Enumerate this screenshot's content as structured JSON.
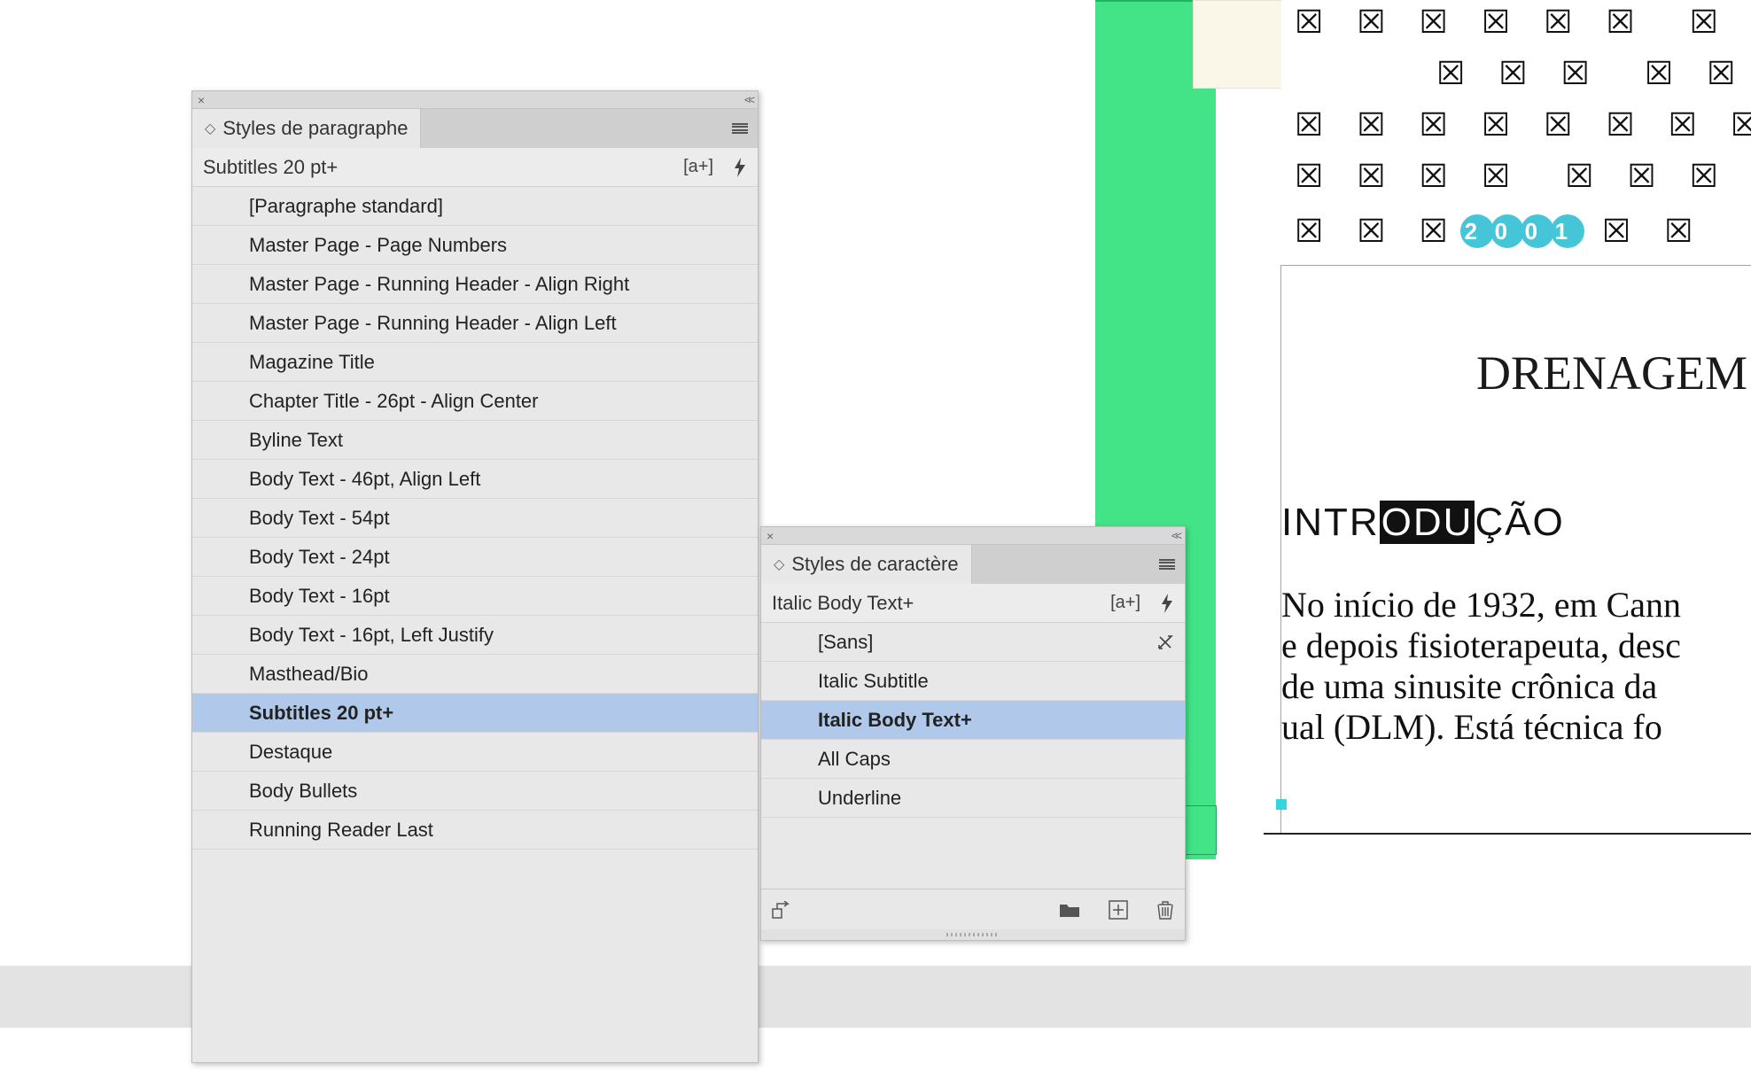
{
  "paragraphPanel": {
    "title": "Styles de paragraphe",
    "currentStyle": "Subtitles 20 pt+",
    "items": [
      "[Paragraphe standard]",
      "Master Page - Page Numbers",
      "Master Page - Running Header - Align Right",
      "Master Page - Running Header - Align Left",
      "Magazine Title",
      "Chapter Title - 26pt - Align Center",
      "Byline Text",
      "Body Text - 46pt, Align Left",
      "Body Text - 54pt",
      "Body Text - 24pt",
      "Body Text - 16pt",
      "Body Text - 16pt, Left Justify",
      "Masthead/Bio",
      "Subtitles 20 pt+",
      "Destaque",
      "Body Bullets",
      "Running Reader Last"
    ],
    "selectedIndex": 13
  },
  "characterPanel": {
    "title": "Styles de caractère",
    "currentStyle": "Italic Body Text+",
    "items": [
      "[Sans]",
      "Italic Subtitle",
      "Italic Body Text+",
      "All Caps",
      "Underline"
    ],
    "selectedIndex": 2,
    "lockedIndex": 0
  },
  "document": {
    "year": "2001",
    "headline": "DRENAGEM",
    "subhead_pre": "INTR",
    "subhead_hl": "ODU",
    "subhead_post": "ÇÃO",
    "body_lines": [
      "No início de 1932, em Cann",
      "e depois fisioterapeuta, desc",
      "de uma sinusite crônica da",
      "ual (DLM). Está técnica fo"
    ]
  }
}
